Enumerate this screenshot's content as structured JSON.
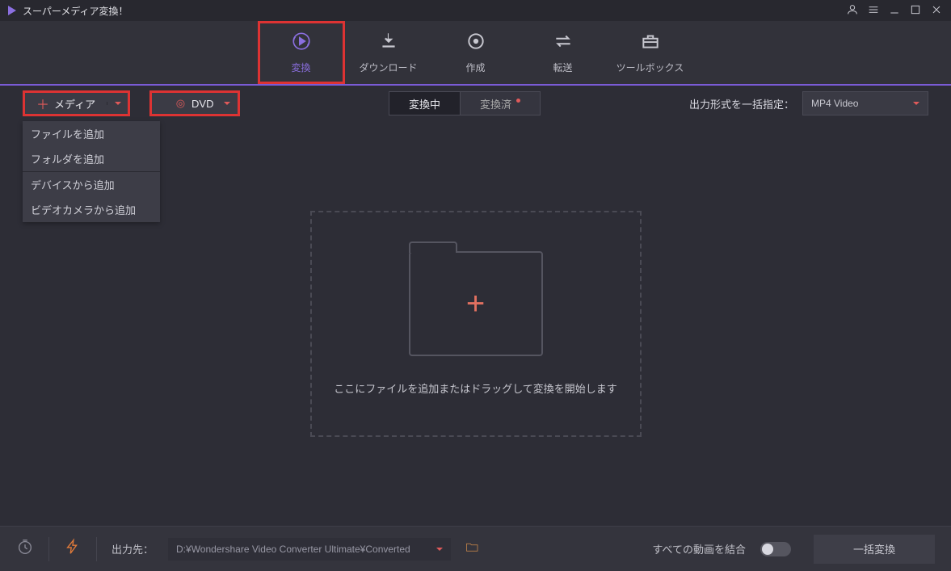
{
  "title": "スーパーメディア変換！",
  "nav": {
    "convert": "変換",
    "download": "ダウンロード",
    "create": "作成",
    "transfer": "転送",
    "toolbox": "ツールボックス"
  },
  "subbar": {
    "media_label": "メディア",
    "dvd_label": "DVD",
    "tab_converting": "変換中",
    "tab_converted": "変換済",
    "output_format_label": "出力形式を一括指定：",
    "output_format_value": "MP4 Video"
  },
  "media_menu": {
    "add_file": "ファイルを追加",
    "add_folder": "フォルダを追加",
    "add_from_device": "デバイスから追加",
    "add_from_camera": "ビデオカメラから追加"
  },
  "dropzone": {
    "text": "ここにファイルを追加またはドラッグして変換を開始します"
  },
  "bottom": {
    "output_dest_label": "出力先：",
    "output_dest_value": "D:¥Wondershare Video Converter Ultimate¥Converted",
    "merge_label": "すべての動画を結合",
    "convert_all": "一括変換"
  }
}
